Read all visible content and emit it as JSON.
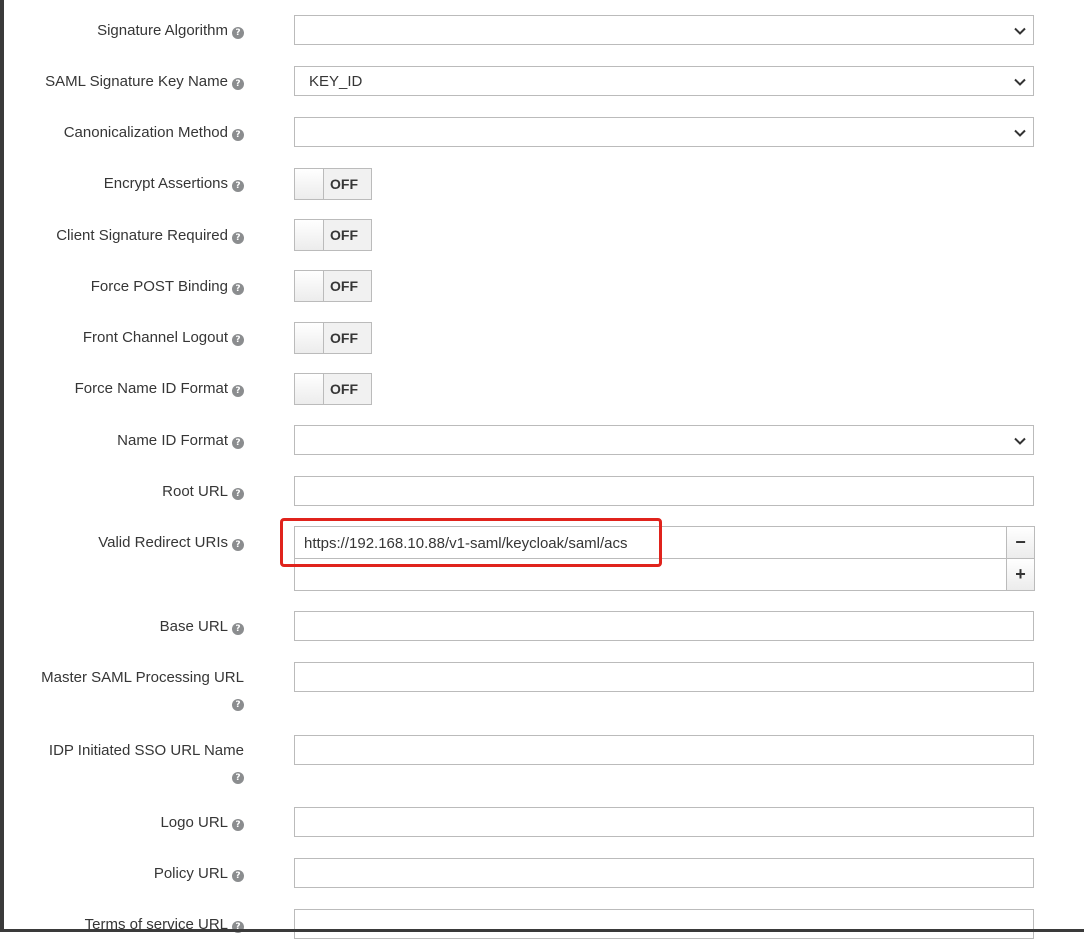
{
  "form": {
    "signature_algorithm": {
      "label": "Signature Algorithm",
      "value": ""
    },
    "saml_signature_key_name": {
      "label": "SAML Signature Key Name",
      "value": "KEY_ID"
    },
    "canonicalization_method": {
      "label": "Canonicalization Method",
      "value": ""
    },
    "encrypt_assertions": {
      "label": "Encrypt Assertions",
      "state": "OFF"
    },
    "client_signature_required": {
      "label": "Client Signature Required",
      "state": "OFF"
    },
    "force_post_binding": {
      "label": "Force POST Binding",
      "state": "OFF"
    },
    "front_channel_logout": {
      "label": "Front Channel Logout",
      "state": "OFF"
    },
    "force_name_id_format": {
      "label": "Force Name ID Format",
      "state": "OFF"
    },
    "name_id_format": {
      "label": "Name ID Format",
      "value": ""
    },
    "root_url": {
      "label": "Root URL",
      "value": ""
    },
    "valid_redirect_uris": {
      "label": "Valid Redirect URIs",
      "values": [
        "https://192.168.10.88/v1-saml/keycloak/saml/acs",
        ""
      ],
      "remove_label": "−",
      "add_label": "+"
    },
    "base_url": {
      "label": "Base URL",
      "value": ""
    },
    "master_saml_processing_url": {
      "label": "Master SAML Processing URL",
      "value": ""
    },
    "idp_initiated_sso_url_name": {
      "label": "IDP Initiated SSO URL Name",
      "value": ""
    },
    "logo_url": {
      "label": "Logo URL",
      "value": ""
    },
    "policy_url": {
      "label": "Policy URL",
      "value": ""
    },
    "terms_of_service_url": {
      "label": "Terms of service URL",
      "value": ""
    }
  },
  "icons": {
    "help": "question-circle-icon",
    "select_arrow": "chevron-down-icon"
  },
  "colors": {
    "highlight": "#e0231c",
    "border": "#bbbbbb",
    "help_icon": "#8b8d8f"
  }
}
